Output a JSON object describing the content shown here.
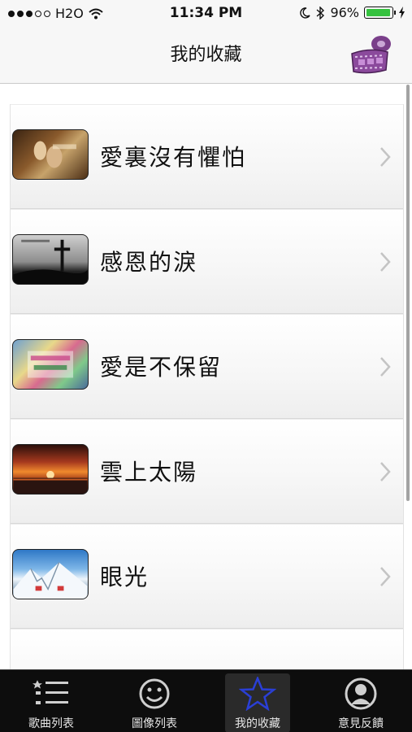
{
  "status_bar": {
    "carrier": "H2O",
    "time": "11:34 PM",
    "battery": "96%",
    "battery_level": 0.96,
    "signal_bars_filled": 3,
    "signal_bars_total": 5
  },
  "nav": {
    "title": "我的收藏"
  },
  "favorites": [
    {
      "title": "愛裏沒有懼怕",
      "thumb_icon": "couple-photo"
    },
    {
      "title": "感恩的淚",
      "thumb_icon": "cross-photo"
    },
    {
      "title": "愛是不保留",
      "thumb_icon": "colorful-text-photo"
    },
    {
      "title": "雲上太陽",
      "thumb_icon": "sunset-photo"
    },
    {
      "title": "眼光",
      "thumb_icon": "snow-mountain-photo"
    }
  ],
  "tab_bar": {
    "tabs": [
      {
        "label": "歌曲列表",
        "icon": "list-icon",
        "selected": false
      },
      {
        "label": "圖像列表",
        "icon": "smiley-icon",
        "selected": false
      },
      {
        "label": "我的收藏",
        "icon": "star-icon",
        "selected": true
      },
      {
        "label": "意見反饋",
        "icon": "person-icon",
        "selected": false
      }
    ]
  },
  "colors": {
    "tab_selected": "#2a3fd6",
    "battery": "#35c23f"
  }
}
